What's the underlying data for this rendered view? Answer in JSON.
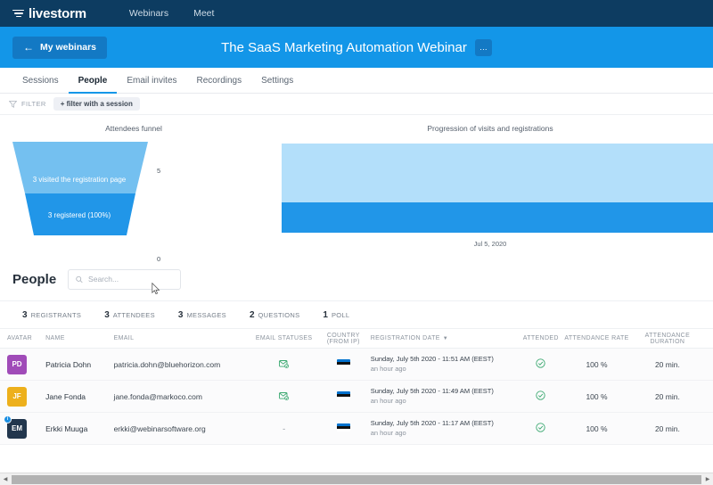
{
  "topnav": {
    "brand": "livestorm",
    "brand_icon": "livestorm-logo-icon",
    "links": [
      {
        "label": "Webinars"
      },
      {
        "label": "Meet"
      }
    ]
  },
  "bluebar": {
    "back_label": "My webinars",
    "back_icon": "arrow-left-icon",
    "webinar_title": "The SaaS Marketing Automation Webinar",
    "more_label": "…"
  },
  "tabs": [
    {
      "label": "Sessions",
      "active": false
    },
    {
      "label": "People",
      "active": true
    },
    {
      "label": "Email invites",
      "active": false
    },
    {
      "label": "Recordings",
      "active": false
    },
    {
      "label": "Settings",
      "active": false
    }
  ],
  "filterbar": {
    "icon": "filter-funnel-icon",
    "label": "FILTER",
    "chip": "+ filter with a session"
  },
  "chart_data": [
    {
      "type": "bar",
      "chart_name": "attendees-funnel",
      "title": "Attendees funnel",
      "categories": [
        "3 visited the registration page",
        "3 registered (100%)"
      ],
      "values": [
        3,
        3
      ],
      "labels": [
        "3 visited the registration page",
        "3 registered (100%)"
      ],
      "axis_ticks": [
        "5",
        "0"
      ],
      "ylim": [
        0,
        5
      ],
      "xlabel": "",
      "ylabel": "",
      "colors": [
        "#74c0f0",
        "#2196e8"
      ],
      "grid": false,
      "legend": "none"
    },
    {
      "type": "area",
      "chart_name": "progression-of-visits-and-registrations",
      "title": "Progression of visits and registrations",
      "x": [
        "Jul 5, 2020"
      ],
      "series": [
        {
          "name": "visits",
          "values": [
            3
          ],
          "color": "#b3dffa"
        },
        {
          "name": "registrations",
          "values": [
            3
          ],
          "color": "#2196e8"
        }
      ],
      "xlabel": "Jul 5, 2020",
      "ylabel": "",
      "grid": false,
      "legend": "none"
    }
  ],
  "people": {
    "title": "People",
    "search_placeholder": "Search...",
    "search_value": "",
    "search_icon": "search-icon"
  },
  "stats": [
    {
      "num": "3",
      "label": "REGISTRANTS"
    },
    {
      "num": "3",
      "label": "ATTENDEES"
    },
    {
      "num": "3",
      "label": "MESSAGES"
    },
    {
      "num": "2",
      "label": "QUESTIONS"
    },
    {
      "num": "1",
      "label": "POLL"
    }
  ],
  "table": {
    "headers": {
      "avatar": "AVATAR",
      "name": "NAME",
      "email": "EMAIL",
      "email_statuses": "EMAIL STATUSES",
      "country": "COUNTRY (FROM IP)",
      "registration_date": "REGISTRATION DATE",
      "sort_caret": "▼",
      "attended": "ATTENDED",
      "attendance_rate": "ATTENDANCE RATE",
      "attendance_duration": "ATTENDANCE DURATION"
    },
    "rows": [
      {
        "initials": "PD",
        "avatar_color": "#a04bb8",
        "badge": "",
        "name": "Patricia Dohn",
        "email": "patricia.dohn@bluehorizon.com",
        "email_status_icon": "envelope-check-icon",
        "email_status_text": "",
        "country_flag": "estonia-flag-icon",
        "reg_date": "Sunday, July 5th 2020 - 11:51 AM (EEST)",
        "reg_ago": "an hour ago",
        "attended_icon": "check-circle-icon",
        "attendance_rate": "100 %",
        "attendance_duration": "20 min."
      },
      {
        "initials": "JF",
        "avatar_color": "#edb01c",
        "badge": "",
        "name": "Jane Fonda",
        "email": "jane.fonda@markoco.com",
        "email_status_icon": "envelope-check-icon",
        "email_status_text": "",
        "country_flag": "estonia-flag-icon",
        "reg_date": "Sunday, July 5th 2020 - 11:49 AM (EEST)",
        "reg_ago": "an hour ago",
        "attended_icon": "check-circle-icon",
        "attendance_rate": "100 %",
        "attendance_duration": "20 min."
      },
      {
        "initials": "EM",
        "avatar_color": "#22364d",
        "badge": "i",
        "name": "Erkki Muuga",
        "email": "erkki@webinarsoftware.org",
        "email_status_icon": "",
        "email_status_text": "-",
        "country_flag": "estonia-flag-icon",
        "reg_date": "Sunday, July 5th 2020 - 11:17 AM (EEST)",
        "reg_ago": "an hour ago",
        "attended_icon": "check-circle-icon",
        "attendance_rate": "100 %",
        "attendance_duration": "20 min."
      }
    ]
  },
  "scrollbar": {
    "left_arrow": "◀",
    "right_arrow": "▶"
  }
}
